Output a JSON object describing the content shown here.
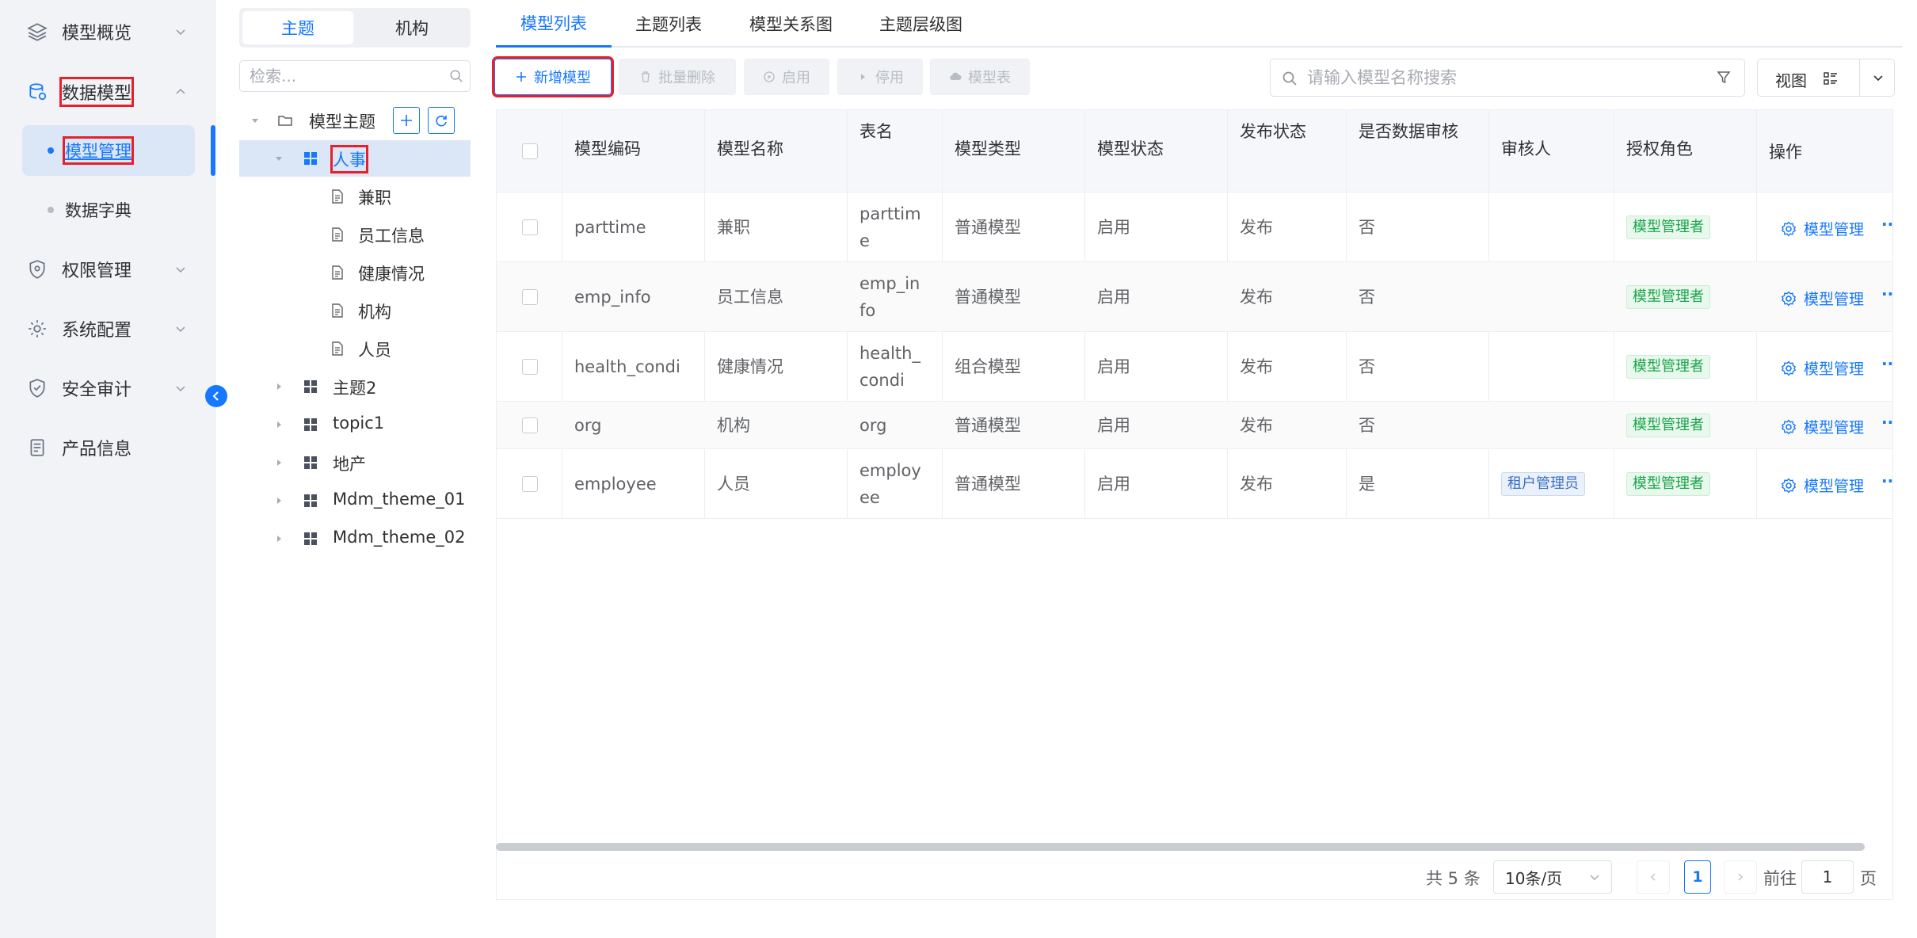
{
  "sidebar": {
    "items": [
      {
        "label": "模型概览",
        "icon": "layers-icon"
      },
      {
        "label": "数据模型",
        "icon": "database-icon"
      },
      {
        "label": "权限管理",
        "icon": "shield-icon"
      },
      {
        "label": "系统配置",
        "icon": "gear-icon"
      },
      {
        "label": "安全审计",
        "icon": "audit-shield-icon"
      },
      {
        "label": "产品信息",
        "icon": "document-icon"
      }
    ],
    "sub_items": [
      {
        "label": "模型管理"
      },
      {
        "label": "数据字典"
      }
    ]
  },
  "tree_panel": {
    "segments": [
      "主题",
      "机构"
    ],
    "search_placeholder": "检索...",
    "root_label": "模型主题",
    "nodes": [
      {
        "label": "人事"
      },
      {
        "label": "兼职"
      },
      {
        "label": "员工信息"
      },
      {
        "label": "健康情况"
      },
      {
        "label": "机构"
      },
      {
        "label": "人员"
      },
      {
        "label": "主题2"
      },
      {
        "label": "topic1"
      },
      {
        "label": "地产"
      },
      {
        "label": "Mdm_theme_01"
      },
      {
        "label": "Mdm_theme_02"
      }
    ]
  },
  "main": {
    "tabs": [
      "模型列表",
      "主题列表",
      "模型关系图",
      "主题层级图"
    ],
    "toolbar": {
      "add": "新增模型",
      "batch_delete": "批量删除",
      "enable": "启用",
      "disable": "停用",
      "model_table": "模型表"
    },
    "search_placeholder": "请输入模型名称搜索",
    "view_label": "视图"
  },
  "table": {
    "columns": [
      "模型编码",
      "模型名称",
      "表名",
      "模型类型",
      "模型状态",
      "发布状态",
      "是否数据审核",
      "审核人",
      "授权角色",
      "操作"
    ],
    "rows": [
      {
        "code": "parttime",
        "name": "兼职",
        "table_l1": "parttim",
        "table_l2": "e",
        "type": "普通模型",
        "status": "启用",
        "publish": "发布",
        "audit": "否",
        "auditor": "",
        "role": "模型管理者",
        "op": "模型管理"
      },
      {
        "code": "emp_info",
        "name": "员工信息",
        "table_l1": "emp_in",
        "table_l2": "fo",
        "type": "普通模型",
        "status": "启用",
        "publish": "发布",
        "audit": "否",
        "auditor": "",
        "role": "模型管理者",
        "op": "模型管理"
      },
      {
        "code": "health_condi",
        "name": "健康情况",
        "table_l1": "health_",
        "table_l2": "condi",
        "type": "组合模型",
        "status": "启用",
        "publish": "发布",
        "audit": "否",
        "auditor": "",
        "role": "模型管理者",
        "op": "模型管理"
      },
      {
        "code": "org",
        "name": "机构",
        "table_l1": "org",
        "table_l2": "",
        "type": "普通模型",
        "status": "启用",
        "publish": "发布",
        "audit": "否",
        "auditor": "",
        "role": "模型管理者",
        "op": "模型管理"
      },
      {
        "code": "employee",
        "name": "人员",
        "table_l1": "employ",
        "table_l2": "ee",
        "type": "普通模型",
        "status": "启用",
        "publish": "发布",
        "audit": "是",
        "auditor": "租户管理员",
        "role": "模型管理者",
        "op": "模型管理"
      }
    ],
    "more": "··"
  },
  "pagination": {
    "total": "共 5 条",
    "page_size": "10条/页",
    "current": "1",
    "goto_prefix": "前往",
    "goto_value": "1",
    "goto_suffix": "页"
  },
  "colors": {
    "accent": "#1677ff",
    "highlight": "#e8202a",
    "tag_green": "#1aa34a"
  }
}
